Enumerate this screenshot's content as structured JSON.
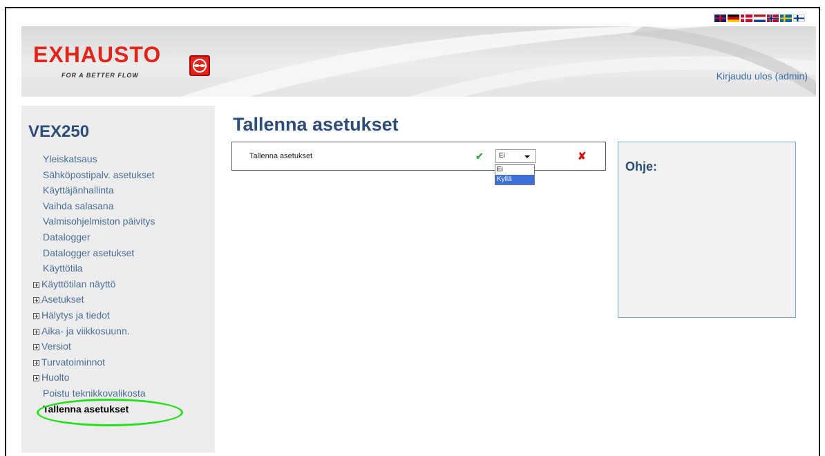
{
  "header": {
    "brand": "EXHAUSTO",
    "tagline": "FOR A BETTER FLOW",
    "logout_label": "Kirjaudu ulos (admin)",
    "language_flags": [
      "uk-flag-icon",
      "de-flag-icon",
      "dk-flag-icon",
      "nl-flag-icon",
      "no-flag-icon",
      "se-flag-icon",
      "fi-flag-icon"
    ]
  },
  "sidebar": {
    "product": "VEX250",
    "items": [
      {
        "label": "Yleiskatsaus"
      },
      {
        "label": "Sähköpostipalv. asetukset"
      },
      {
        "label": "Käyttäjänhallinta"
      },
      {
        "label": "Vaihda salasana"
      },
      {
        "label": "Valmisohjelmiston päivitys"
      },
      {
        "label": "Datalogger"
      },
      {
        "label": "Datalogger asetukset"
      },
      {
        "label": "Käyttötila"
      },
      {
        "label": "Käyttötilan näyttö"
      },
      {
        "label": "Asetukset"
      },
      {
        "label": "Hälytys ja tiedot"
      },
      {
        "label": "Aika- ja viikkosuunn."
      },
      {
        "label": "Versiot"
      },
      {
        "label": "Turvatoiminnot"
      },
      {
        "label": "Huolto"
      },
      {
        "label": "Poistu teknikkovalikosta"
      },
      {
        "label": "Tallenna asetukset"
      }
    ]
  },
  "main": {
    "title": "Tallenna asetukset",
    "setting": {
      "label": "Tallenna asetukset",
      "selected": "Ei",
      "options": [
        "Ei",
        "Kyllä"
      ],
      "highlighted_option": "Kyllä"
    }
  },
  "help": {
    "title": "Ohje:"
  },
  "colors": {
    "brand_red": "#e3241b",
    "heading_blue": "#2c4d78",
    "link_blue": "#4a6e96",
    "highlight_green": "#22e01a"
  }
}
